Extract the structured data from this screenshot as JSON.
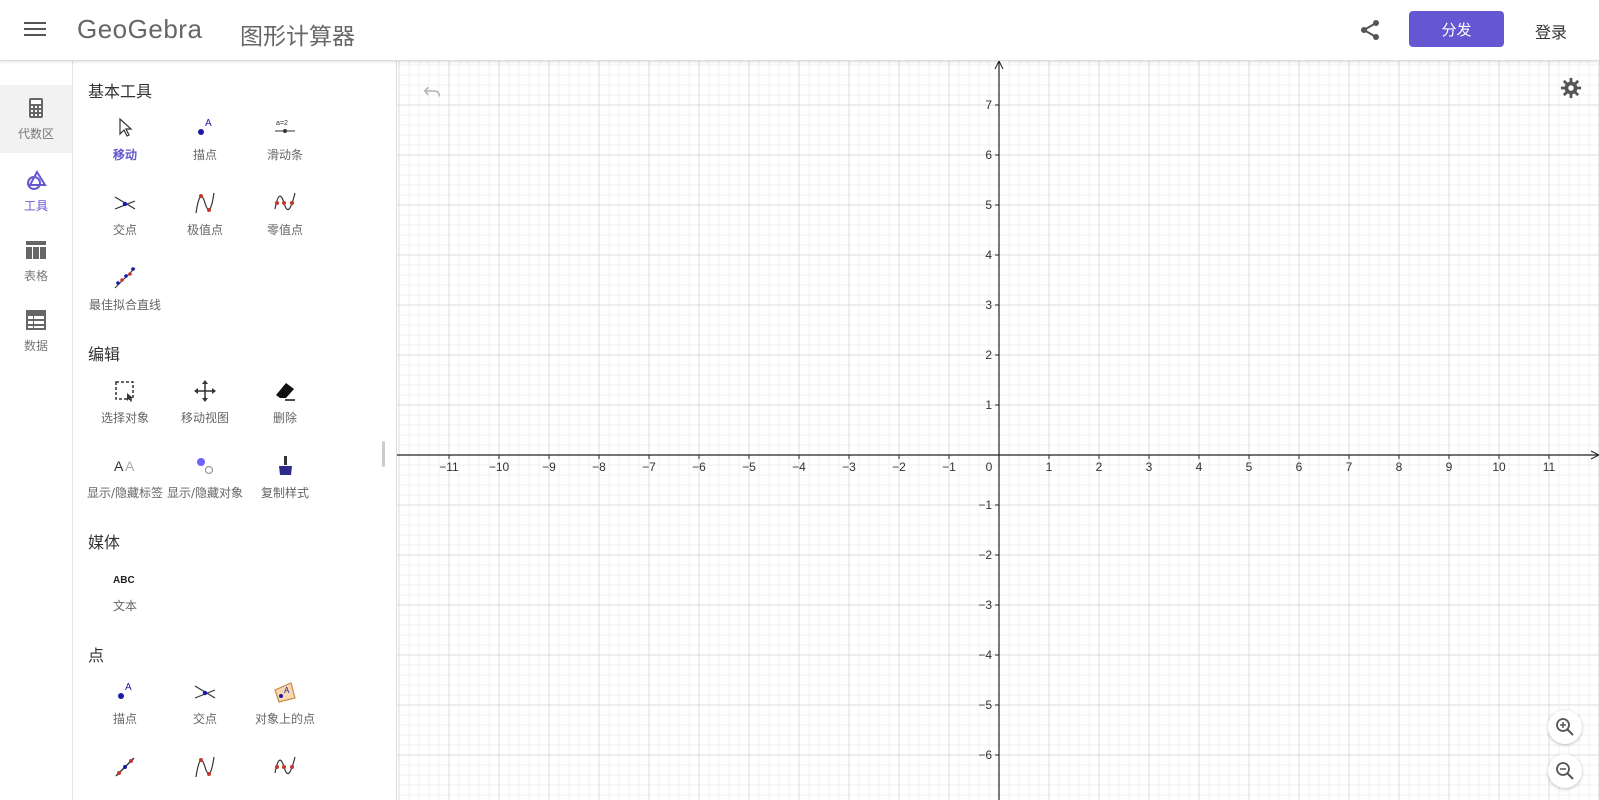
{
  "header": {
    "brand": "GeoGebra",
    "subtitle": "图形计算器",
    "publish_label": "分发",
    "login_label": "登录"
  },
  "rail": {
    "items": [
      {
        "label": "代数区",
        "icon": "calculator-icon"
      },
      {
        "label": "工具",
        "icon": "tools-shape-icon"
      },
      {
        "label": "表格",
        "icon": "table-icon"
      },
      {
        "label": "数据",
        "icon": "data-grid-icon"
      }
    ]
  },
  "tools": {
    "sections": [
      {
        "title": "基本工具",
        "items": [
          {
            "label": "移动",
            "icon": "move-arrow-icon"
          },
          {
            "label": "描点",
            "icon": "point-icon"
          },
          {
            "label": "滑动条",
            "icon": "slider-icon"
          },
          {
            "label": "交点",
            "icon": "intersect-icon"
          },
          {
            "label": "极值点",
            "icon": "extremum-icon"
          },
          {
            "label": "零值点",
            "icon": "roots-icon"
          },
          {
            "label": "最佳拟合直线",
            "icon": "fit-line-icon"
          }
        ]
      },
      {
        "title": "编辑",
        "items": [
          {
            "label": "选择对象",
            "icon": "select-rect-icon"
          },
          {
            "label": "移动视图",
            "icon": "move-view-icon"
          },
          {
            "label": "删除",
            "icon": "eraser-icon"
          },
          {
            "label": "显示/隐藏标签",
            "icon": "show-label-icon"
          },
          {
            "label": "显示/隐藏对象",
            "icon": "show-object-icon"
          },
          {
            "label": "复制样式",
            "icon": "brush-icon"
          }
        ]
      },
      {
        "title": "媒体",
        "items": [
          {
            "label": "文本",
            "icon": "text-abc-icon",
            "glyph": "ABC"
          }
        ]
      },
      {
        "title": "点",
        "items": [
          {
            "label": "描点",
            "icon": "point-icon"
          },
          {
            "label": "交点",
            "icon": "intersect-icon"
          },
          {
            "label": "对象上的点",
            "icon": "point-on-object-icon"
          }
        ]
      }
    ]
  },
  "graphics": {
    "x_ticks": [
      "−11",
      "−10",
      "−9",
      "−8",
      "−7",
      "−6",
      "−5",
      "−4",
      "−3",
      "−2",
      "−1",
      "0",
      "1",
      "2",
      "3",
      "4",
      "5",
      "6",
      "7",
      "8",
      "9",
      "10",
      "11"
    ],
    "y_ticks_pos": [
      "1",
      "2",
      "3",
      "4",
      "5",
      "6",
      "7"
    ],
    "y_ticks_neg": [
      "−1",
      "−2",
      "−3",
      "−4",
      "−5",
      "−6"
    ],
    "grid": true
  },
  "colors": {
    "accent": "#6557d2",
    "point": "#1a1aa6",
    "grid_major": "#dcdcdc",
    "grid_minor": "#f0f0f0"
  }
}
